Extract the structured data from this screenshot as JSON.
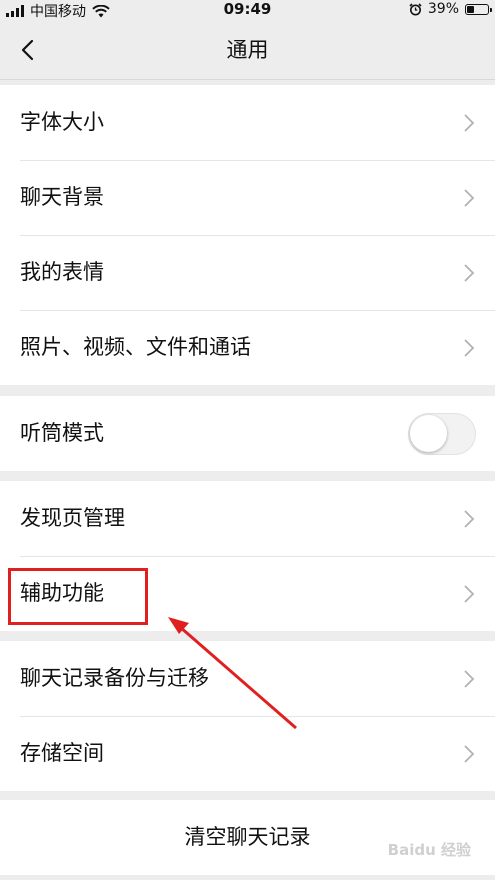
{
  "status_bar": {
    "carrier": "中国移动",
    "time": "09:49",
    "battery": "39%",
    "battery_level": 0.39
  },
  "nav": {
    "title": "通用"
  },
  "groups": {
    "display": [
      "字体大小",
      "聊天背景",
      "我的表情",
      "照片、视频、文件和通话"
    ],
    "earpiece": {
      "label": "听筒模式",
      "enabled": false
    },
    "features": [
      "发现页管理",
      "辅助功能"
    ],
    "storage": [
      "聊天记录备份与迁移",
      "存储空间"
    ],
    "clear_button": "清空聊天记录"
  },
  "annotation": {
    "highlight_color": "#e02020"
  },
  "watermark": {
    "text": "Baidu 经验"
  },
  "colors": {
    "background": "#ededed",
    "cell": "#ffffff",
    "text": "#111111",
    "chevron": "#b2b2b2"
  }
}
